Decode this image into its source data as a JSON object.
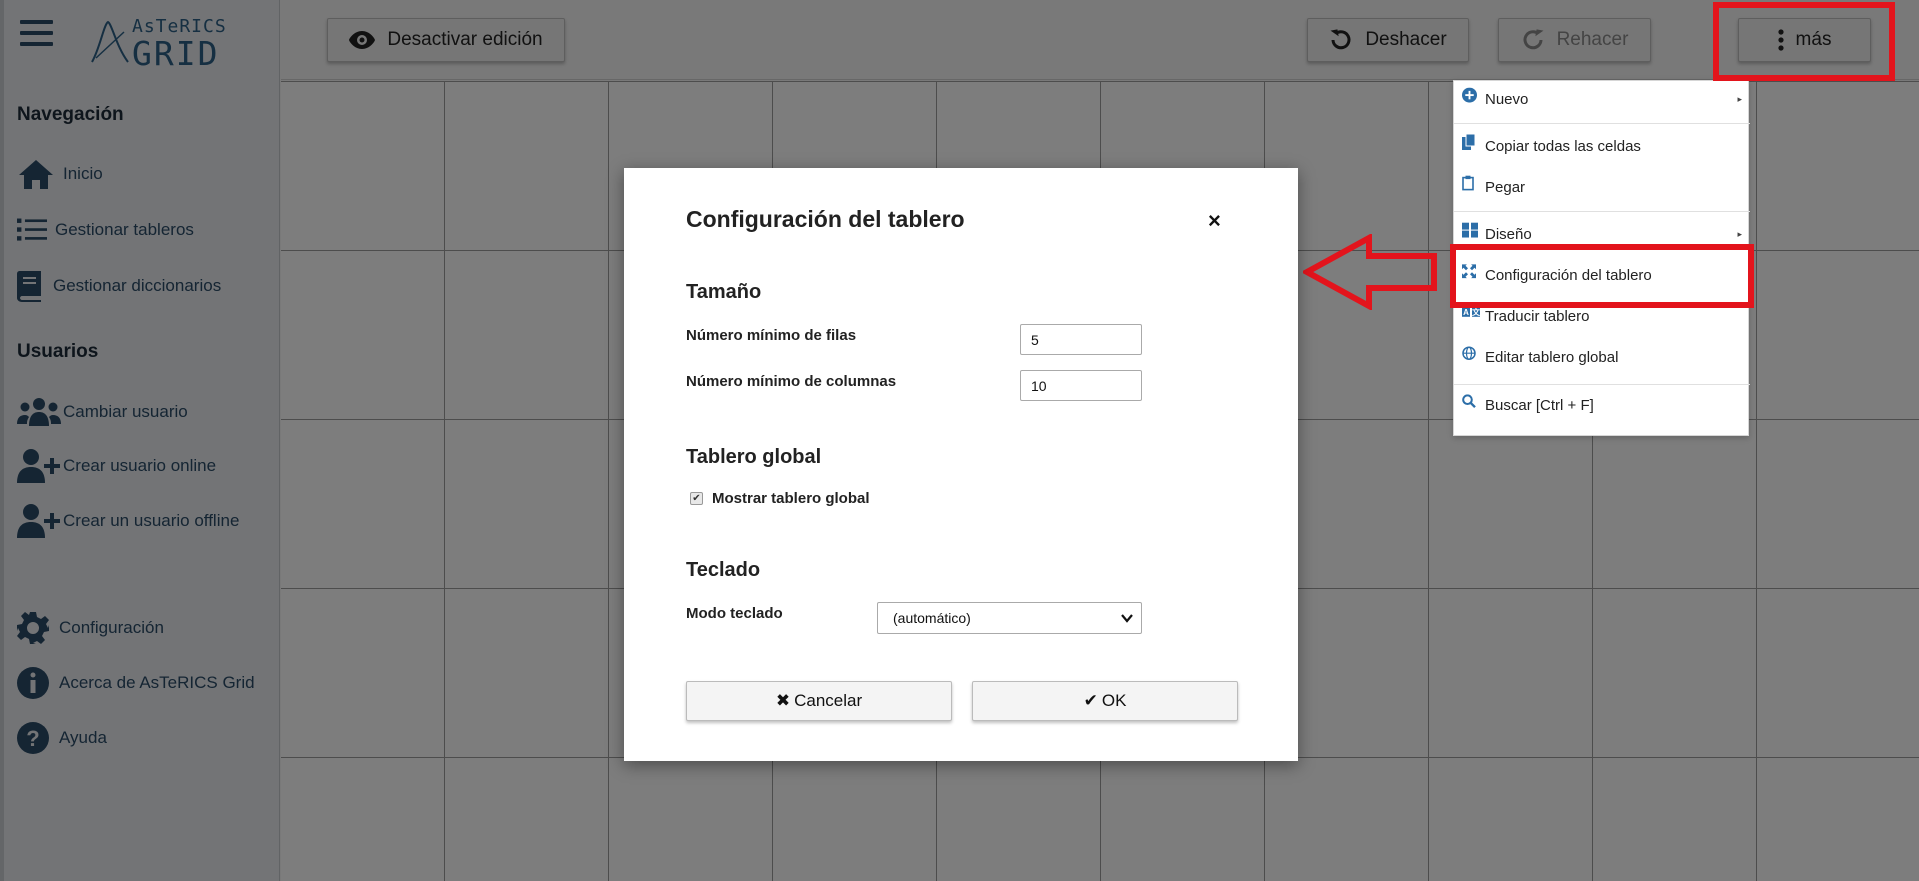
{
  "logo": {
    "top": "AsTeRICS",
    "bottom": "GRID"
  },
  "sidebar": {
    "nav_heading": "Navegación",
    "nav_items": [
      {
        "label": "Inicio",
        "icon": "home-icon"
      },
      {
        "label": "Gestionar tableros",
        "icon": "list-icon"
      },
      {
        "label": "Gestionar diccionarios",
        "icon": "book-icon"
      }
    ],
    "users_heading": "Usuarios",
    "user_items": [
      {
        "label": "Cambiar usuario",
        "icon": "users-icon"
      },
      {
        "label": "Crear usuario online",
        "icon": "user-plus-icon"
      },
      {
        "label": "Crear un usuario offline",
        "icon": "user-plus-icon"
      }
    ],
    "bottom_items": [
      {
        "label": "Configuración",
        "icon": "gear-icon"
      },
      {
        "label": "Acerca de AsTeRICS Grid",
        "icon": "info-icon"
      },
      {
        "label": "Ayuda",
        "icon": "question-icon"
      }
    ]
  },
  "toolbar": {
    "edit_label": "Desactivar edición",
    "undo_label": "Deshacer",
    "redo_label": "Rehacer",
    "more_label": "más"
  },
  "menu": {
    "items": [
      {
        "label": "Nuevo",
        "icon": "plus-circle-icon",
        "submenu": true
      },
      {
        "label": "Copiar todas las celdas",
        "icon": "copy-icon"
      },
      {
        "label": "Pegar",
        "icon": "clipboard-icon"
      },
      {
        "label": "Diseño",
        "icon": "layout-icon",
        "submenu": true
      },
      {
        "label": "Configuración del tablero",
        "icon": "expand-icon"
      },
      {
        "label": "Traducir tablero",
        "icon": "translate-icon"
      },
      {
        "label": "Editar tablero global",
        "icon": "globe-icon"
      },
      {
        "label": "Buscar [Ctrl + F]",
        "icon": "search-icon"
      }
    ],
    "submenu_arrow": "▸"
  },
  "dialog": {
    "title": "Configuración del tablero",
    "close": "×",
    "size_heading": "Tamaño",
    "min_rows_label": "Número mínimo de filas",
    "min_rows_value": "5",
    "min_cols_label": "Número mínimo de columnas",
    "min_cols_value": "10",
    "global_heading": "Tablero global",
    "show_global_label": "Mostrar tablero global",
    "keyboard_heading": "Teclado",
    "keyboard_mode_label": "Modo teclado",
    "keyboard_mode_value": "(automático)",
    "cancel_label": "Cancelar",
    "cancel_icon": "✖",
    "ok_label": "OK",
    "ok_icon": "✔"
  },
  "colors": {
    "accent": "#2a4a66",
    "highlight": "#e3141c",
    "menu_icon": "#2c6ea8"
  }
}
